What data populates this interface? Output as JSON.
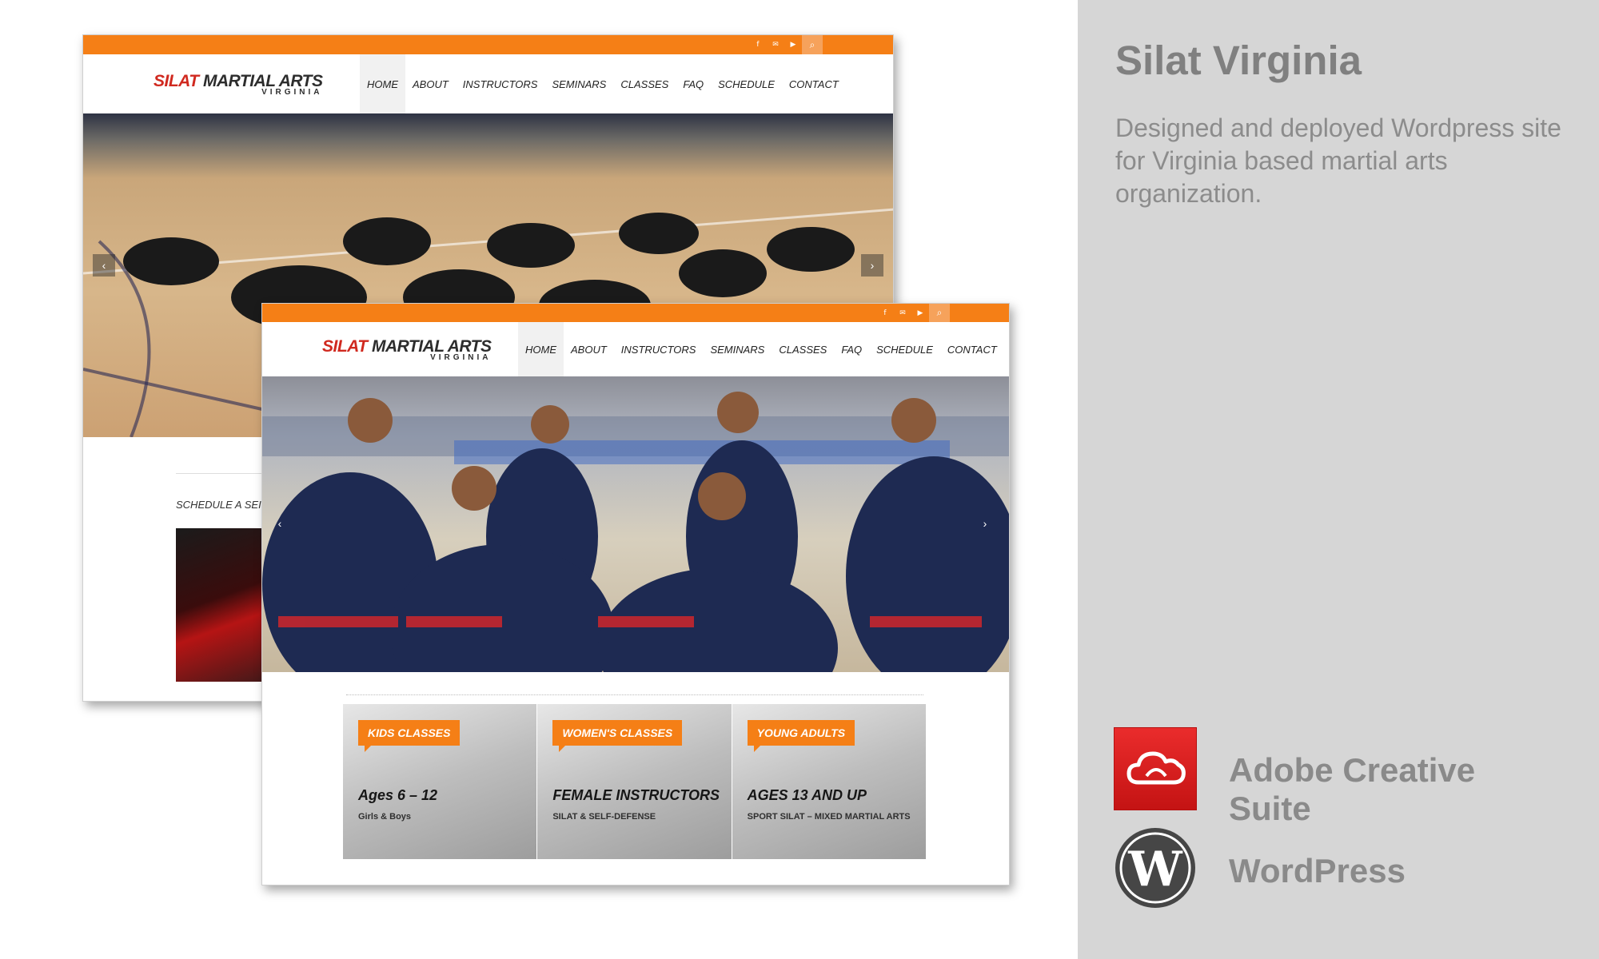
{
  "panel": {
    "title": "Silat Virginia",
    "description": "Designed and deployed Wordpress site for Virginia based martial arts organization.",
    "tools": [
      {
        "label": "Adobe Creative Suite",
        "icon": "adobe-creative-cloud-icon"
      },
      {
        "label": "WordPress",
        "icon": "wordpress-icon"
      }
    ]
  },
  "site": {
    "logo": {
      "word1": "SILAT",
      "word2": "MARTIAL ARTS",
      "sub": "VIRGINIA"
    },
    "social": [
      {
        "glyph": "f",
        "icon": "facebook-icon"
      },
      {
        "glyph": "✉",
        "icon": "mail-icon"
      },
      {
        "glyph": "▶",
        "icon": "youtube-icon"
      },
      {
        "glyph": "⌕",
        "icon": "search-icon"
      }
    ],
    "nav": [
      "HOME",
      "ABOUT",
      "INSTRUCTORS",
      "SEMINARS",
      "CLASSES",
      "FAQ",
      "SCHEDULE",
      "CONTACT"
    ],
    "arrows": {
      "prev": "‹",
      "next": "›"
    },
    "back_schedule": "SCHEDULE A SEI",
    "cards": [
      {
        "tag": "KIDS CLASSES",
        "title": "Ages 6 – 12",
        "sub": "Girls & Boys"
      },
      {
        "tag": "WOMEN'S CLASSES",
        "title": "FEMALE INSTRUCTORS",
        "sub": "SILAT & SELF-DEFENSE"
      },
      {
        "tag": "YOUNG ADULTS",
        "title": "AGES 13 AND UP",
        "sub": "SPORT SILAT – MIXED MARTIAL ARTS"
      }
    ]
  },
  "colors": {
    "accent_orange": "#f57f16",
    "logo_red": "#d0291f",
    "panel_gray": "#d6d6d6",
    "adobe_red": "#da1f26",
    "wordpress_dark": "#464646"
  }
}
